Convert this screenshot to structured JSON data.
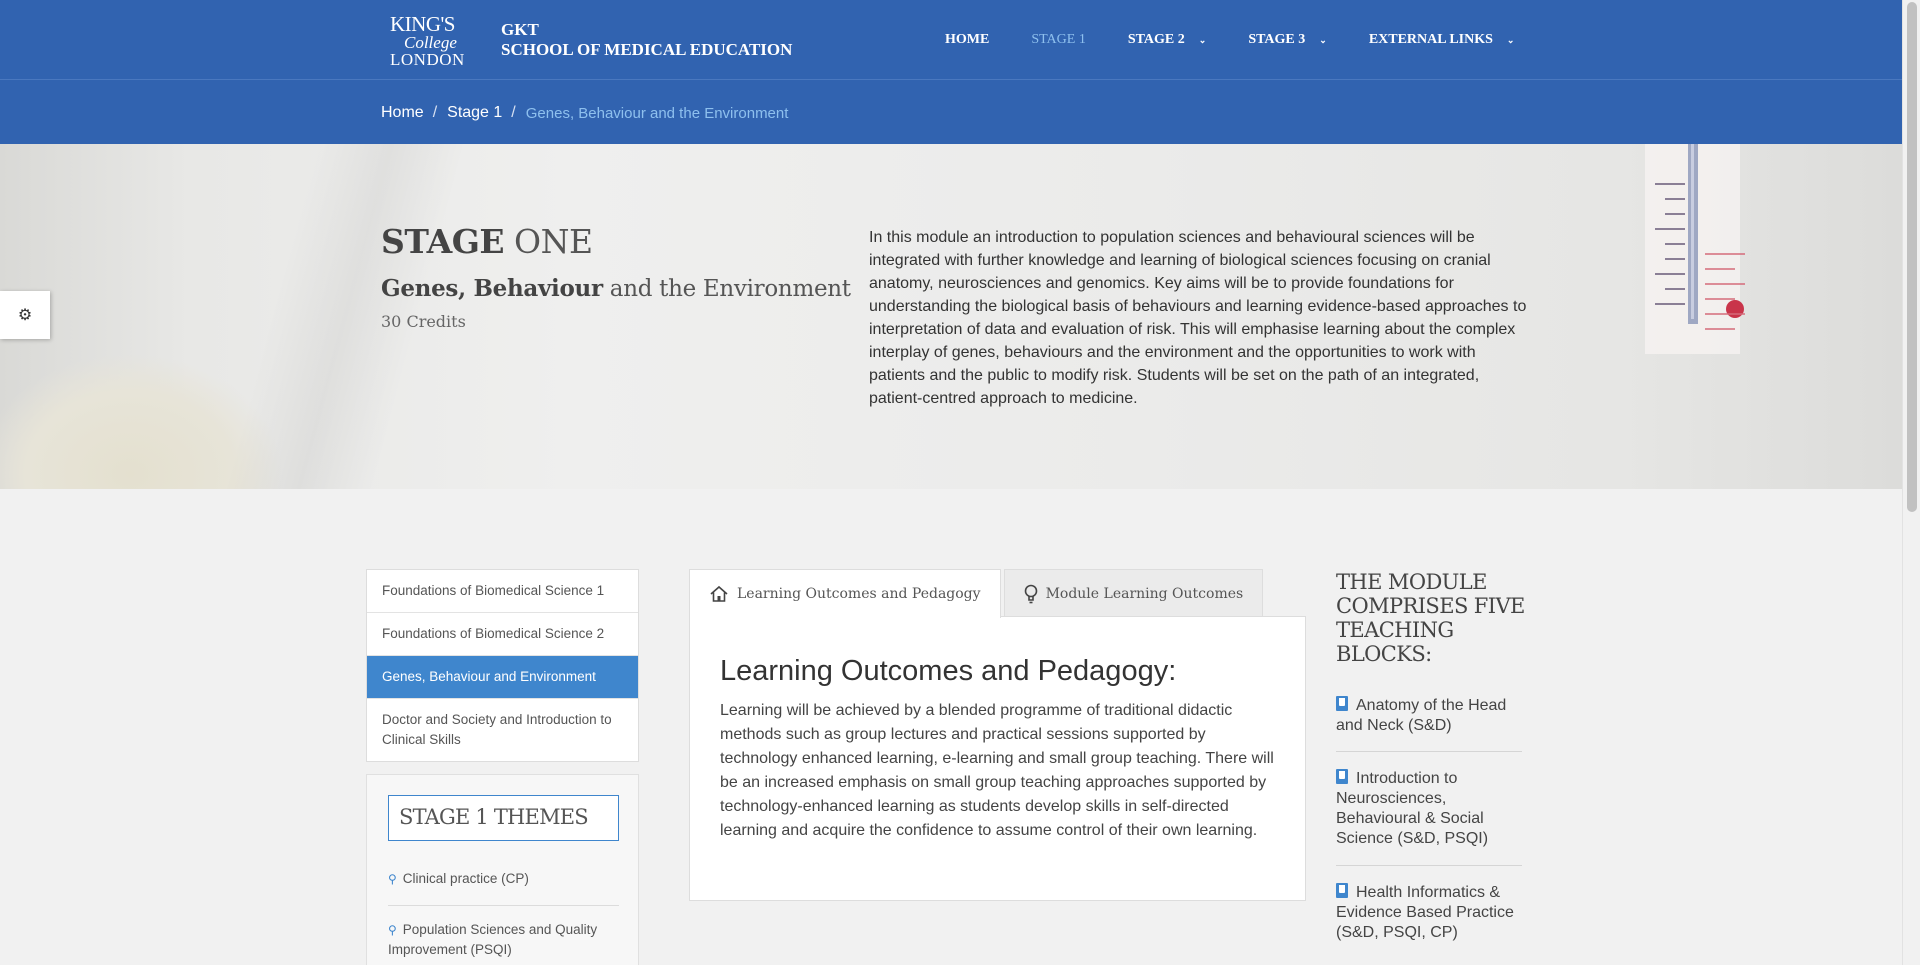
{
  "header": {
    "logo": {
      "line1": "KING'S",
      "line2": "College",
      "line3": "LONDON"
    },
    "school_line1": "GKT",
    "school_line2": "SCHOOL OF MEDICAL EDUCATION",
    "nav": [
      {
        "label": "HOME",
        "active": false,
        "dropdown": false
      },
      {
        "label": "STAGE 1",
        "active": true,
        "dropdown": false
      },
      {
        "label": "STAGE 2",
        "active": false,
        "dropdown": true
      },
      {
        "label": "STAGE 3",
        "active": false,
        "dropdown": true
      },
      {
        "label": "EXTERNAL LINKS",
        "active": false,
        "dropdown": true
      }
    ],
    "brand_color": "#3163b0"
  },
  "breadcrumb": {
    "items": [
      "Home",
      "Stage 1"
    ],
    "separator": "/",
    "current": "Genes, Behaviour and the Environment"
  },
  "hero": {
    "title_bold": "STAGE",
    "title_rest": "ONE",
    "subtitle_bold": "Genes, Behaviour",
    "subtitle_rest": "and the Environment",
    "credits": "30 Credits",
    "description": "In this module an introduction to population sciences and behavioural sciences will be integrated with further knowledge and learning of biological sciences focusing on cranial anatomy, neurosciences and genomics. Key aims will be to provide foundations for understanding the biological basis of behaviours and learning evidence-based approaches to interpretation of data and evaluation of risk. This will emphasise learning about the complex interplay of genes, behaviours and the environment and the opportunities to work with patients and the public to modify risk. Students will be set on the path of an integrated, patient-centred approach to medicine."
  },
  "settings_tab": {
    "icon": "gear-icon"
  },
  "sidebar": {
    "modules": [
      {
        "label": "Foundations of Biomedical Science 1",
        "active": false
      },
      {
        "label": "Foundations of Biomedical Science 2",
        "active": false
      },
      {
        "label": "Genes, Behaviour and Environment",
        "active": true
      },
      {
        "label": "Doctor and Society and Introduction to Clinical Skills",
        "active": false
      }
    ],
    "themes_title": "STAGE 1 THEMES",
    "themes": [
      "Clinical practice (CP)",
      "Population Sciences and Quality Improvement (PSQI)"
    ],
    "accent_color": "#3f86cd"
  },
  "tabs": [
    {
      "label": "Learning Outcomes and Pedagogy",
      "icon": "home-icon",
      "active": true
    },
    {
      "label": "Module Learning Outcomes",
      "icon": "lightbulb-icon",
      "active": false
    }
  ],
  "panel": {
    "heading": "Learning Outcomes and Pedagogy:",
    "body": "Learning will be achieved by a blended programme of traditional didactic methods such as group lectures and practical sessions supported by technology enhanced learning, e-learning and small group teaching. There will be an increased emphasis on small group teaching approaches supported by technology-enhanced learning as students develop skills in self-directed learning and acquire the confidence to assume control of their own learning."
  },
  "teaching_blocks": {
    "title": "THE MODULE COMPRISES FIVE TEACHING BLOCKS:",
    "items": [
      "Anatomy of the Head and Neck (S&D)",
      "Introduction to Neurosciences, Behavioural & Social Science (S&D, PSQI)",
      "Health Informatics & Evidence Based Practice (S&D, PSQI, CP)"
    ]
  }
}
